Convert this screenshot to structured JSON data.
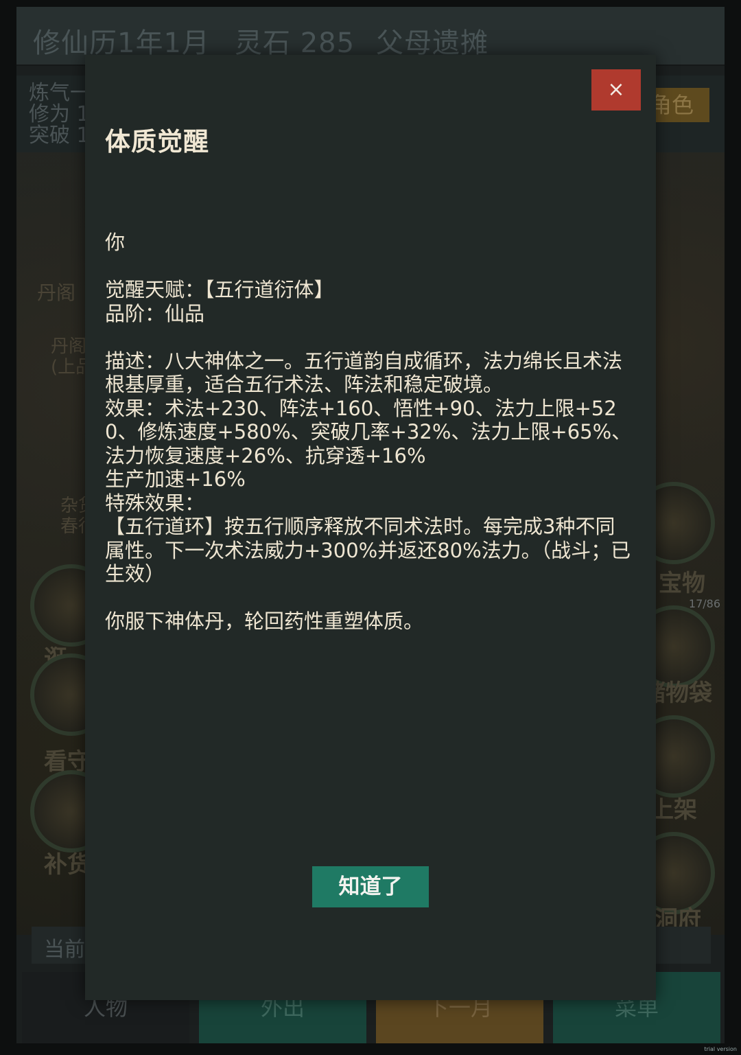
{
  "topbar": {
    "date": "修仙历1年1月",
    "spirit_stones": "灵石 285",
    "title": "父母遗摊"
  },
  "status": {
    "line1": "炼气一",
    "line2": "修为 1",
    "line3": "突破 1",
    "role_button": "角色"
  },
  "scene": {
    "sign_dange": "丹阁",
    "sign_dange_sub": "丹阁\n(上品",
    "sign_zahuo": "杂货\n春行",
    "caption_guang": "逛",
    "caption_kan": "看守",
    "caption_bu": "补货",
    "caption_bao": "宝物",
    "caption_chu": "储物袋",
    "caption_shang": "上架",
    "caption_dong": "洞府",
    "bag_count": "17/86"
  },
  "current_bar": "当前",
  "bottom_nav": {
    "character": "人物",
    "outing": "外出",
    "next_month": "下一月",
    "menu": "菜单"
  },
  "modal": {
    "close_label": "×",
    "title": "体质觉醒",
    "lines": {
      "intro": "你",
      "talent": "觉醒天赋：【五行道衍体】",
      "grade": "品阶：仙品",
      "description": "描述：八大神体之一。五行道韵自成循环，法力绵长且术法根基厚重，适合五行术法、阵法和稳定破境。",
      "effects": "效果：术法+230、阵法+160、悟性+90、法力上限+520、修炼速度+580%、突破几率+32%、法力上限+65%、法力恢复速度+26%、抗穿透+16%",
      "production": "生产加速+16%",
      "special_header": "特殊效果：",
      "special_text": "【五行道环】按五行顺序释放不同术法时。每完成3种不同属性。下一次术法威力+300%并返还80%法力。（战斗；已生效）",
      "outro": "你服下神体丹，轮回药性重塑体质。"
    },
    "ok_label": "知道了"
  },
  "watermark": "trial version"
}
